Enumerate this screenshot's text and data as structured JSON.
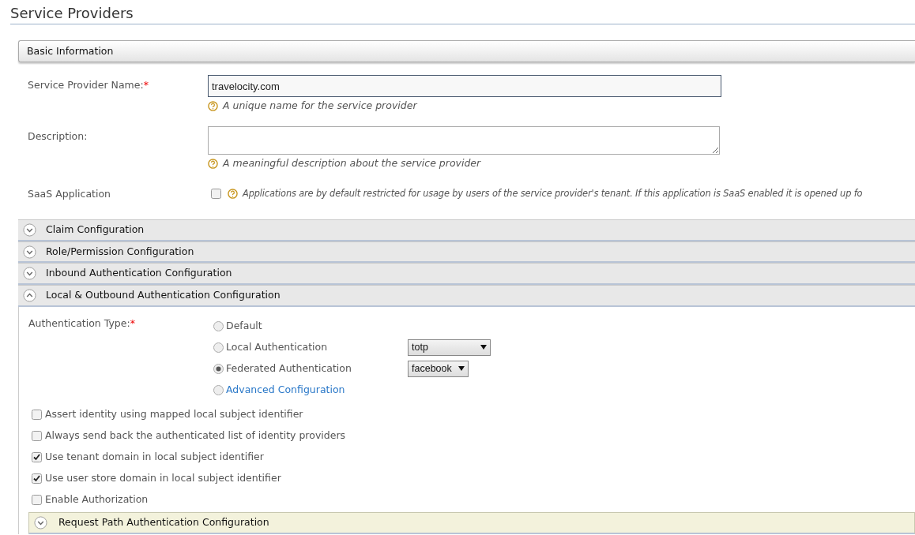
{
  "page_title": "Service Providers",
  "basic": {
    "title": "Basic Information",
    "name_field": {
      "label": "Service Provider Name:",
      "required_mark": "*",
      "value": "travelocity.com",
      "help": "A unique name for the service provider"
    },
    "description_field": {
      "label": "Description:",
      "help": "A meaningful description about the service provider"
    },
    "saas": {
      "label": "SaaS Application",
      "checked": false,
      "help": "Applications are by default restricted for usage by users of the service provider's tenant. If this application is SaaS enabled it is opened up fo"
    }
  },
  "sections": [
    {
      "title": "Claim Configuration",
      "expanded": false
    },
    {
      "title": "Role/Permission Configuration",
      "expanded": false
    },
    {
      "title": "Inbound Authentication Configuration",
      "expanded": false
    },
    {
      "title": "Local & Outbound Authentication Configuration",
      "expanded": true,
      "body": {
        "auth_label": "Authentication Type:",
        "required_mark": "*",
        "options": [
          {
            "label": "Default",
            "selected": false,
            "kind": "plain"
          },
          {
            "label": "Local Authentication",
            "selected": false,
            "kind": "select",
            "select_value": "totp"
          },
          {
            "label": "Federated Authentication",
            "selected": true,
            "kind": "select",
            "select_value": "facebook"
          },
          {
            "label": "Advanced Configuration",
            "selected": false,
            "kind": "link"
          }
        ],
        "checkboxes": [
          {
            "label": "Assert identity using mapped local subject identifier",
            "checked": false
          },
          {
            "label": "Always send back the authenticated list of identity providers",
            "checked": false
          },
          {
            "label": "Use tenant domain in local subject identifier",
            "checked": true
          },
          {
            "label": "Use user store domain in local subject identifier",
            "checked": true
          },
          {
            "label": "Enable Authorization",
            "checked": false
          }
        ],
        "subsection": {
          "title": "Request Path Authentication Configuration",
          "expanded": false
        }
      }
    }
  ]
}
